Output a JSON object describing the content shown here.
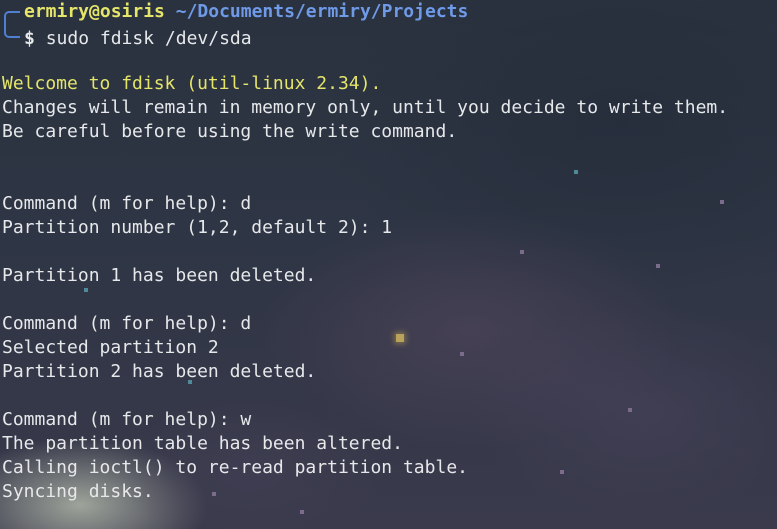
{
  "prompt": {
    "user_host": "ermiry@osiris",
    "cwd": "~/Documents/ermiry/Projects",
    "symbol": "$",
    "command": "sudo fdisk /dev/sda"
  },
  "output": {
    "welcome": "Welcome to fdisk (util-linux 2.34).",
    "notice_1": "Changes will remain in memory only, until you decide to write them.",
    "notice_2": "Be careful before using the write command.",
    "cmd_1": "Command (m for help): d",
    "partition_prompt": "Partition number (1,2, default 2): 1",
    "deleted_1": "Partition 1 has been deleted.",
    "cmd_2": "Command (m for help): d",
    "selected": "Selected partition 2",
    "deleted_2": "Partition 2 has been deleted.",
    "cmd_3": "Command (m for help): w",
    "altered": "The partition table has been altered.",
    "ioctl": "Calling ioctl() to re-read partition table.",
    "syncing": "Syncing disks."
  },
  "colors": {
    "prompt_user": "#e5e56a",
    "prompt_path": "#6f9ae8",
    "welcome_text": "#e5e56a",
    "output_text": "#e6e8ea",
    "background": "#2c3441"
  }
}
